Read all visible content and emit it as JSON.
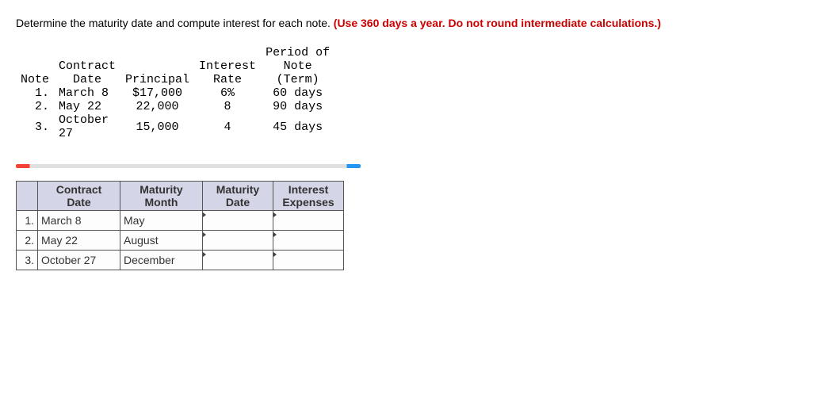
{
  "instruction": {
    "part1": "Determine the maturity date and compute interest for each note. ",
    "part2": "(Use 360 days a year. Do not round intermediate calculations.)"
  },
  "given_table": {
    "headers": {
      "note": "Note",
      "date": "Contract Date",
      "principal": "Principal",
      "rate": "Interest Rate",
      "term": "Period of Note (Term)"
    },
    "rows": [
      {
        "num": "1.",
        "date": "March 8",
        "principal": "$17,000",
        "rate": "6%",
        "term": "60 days"
      },
      {
        "num": "2.",
        "date": "May 22",
        "principal": "22,000",
        "rate": "8",
        "term": "90 days"
      },
      {
        "num": "3.",
        "date": "October 27",
        "principal": "15,000",
        "rate": "4",
        "term": "45 days"
      }
    ]
  },
  "answer_table": {
    "headers": {
      "blank": "",
      "contract_date": "Contract Date",
      "maturity_month": "Maturity Month",
      "maturity_date": "Maturity Date",
      "interest_expenses": "Interest Expenses"
    },
    "rows": [
      {
        "num": "1.",
        "contract_date": "March 8",
        "maturity_month": "May",
        "maturity_date": "",
        "interest_expenses": ""
      },
      {
        "num": "2.",
        "contract_date": "May 22",
        "maturity_month": "August",
        "maturity_date": "",
        "interest_expenses": ""
      },
      {
        "num": "3.",
        "contract_date": "October 27",
        "maturity_month": "December",
        "maturity_date": "",
        "interest_expenses": ""
      }
    ]
  }
}
